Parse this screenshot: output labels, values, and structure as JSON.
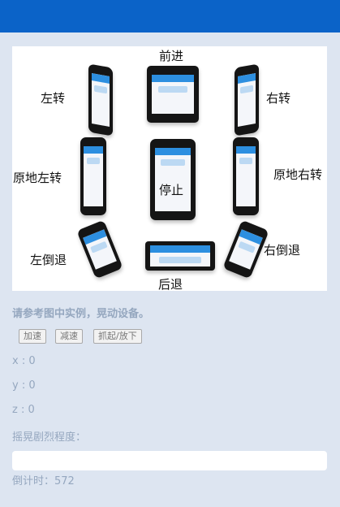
{
  "header": {
    "accent": "#0b63c8"
  },
  "demo_image": {
    "labels": {
      "forward": "前进",
      "turn_left": "左转",
      "turn_right": "右转",
      "spin_left": "原地左转",
      "stop": "停止",
      "spin_right": "原地右转",
      "back_left": "左倒退",
      "back_right": "右倒退",
      "backward": "后退"
    }
  },
  "instructions": "请参考图中实例，晃动设备。",
  "buttons": {
    "accelerate": "加速",
    "decelerate": "减速",
    "grab_release": "抓起/放下"
  },
  "readouts": {
    "x": "x : 0",
    "y": "y : 0",
    "z": "z : 0",
    "shake_label": "摇晃剧烈程度："
  },
  "shake_level": 0,
  "countdown": "倒计时：572"
}
